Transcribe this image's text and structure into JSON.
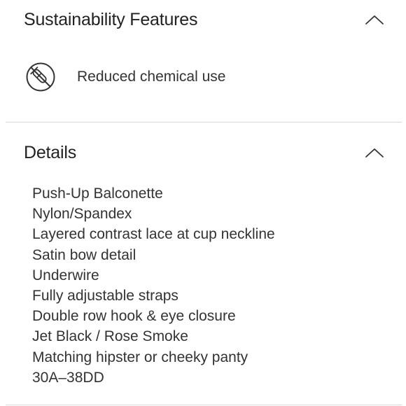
{
  "sustainability": {
    "title": "Sustainability Features",
    "toggle_icon": "chevron-up-icon",
    "features": [
      {
        "icon": "no-chemical-icon",
        "label": "Reduced chemical use"
      }
    ]
  },
  "details": {
    "title": "Details",
    "toggle_icon": "chevron-up-icon",
    "items": [
      "Push-Up Balconette",
      "Nylon/Spandex",
      "Layered contrast lace at cup neckline",
      "Satin bow detail",
      "Underwire",
      "Fully adjustable straps",
      "Double row hook & eye closure",
      "Jet Black / Rose Smoke",
      "Matching hipster or cheeky panty",
      "30A–38DD"
    ]
  },
  "colors": {
    "text": "#2b2b2b",
    "divider": "#d9d9d9",
    "background": "#ffffff"
  }
}
